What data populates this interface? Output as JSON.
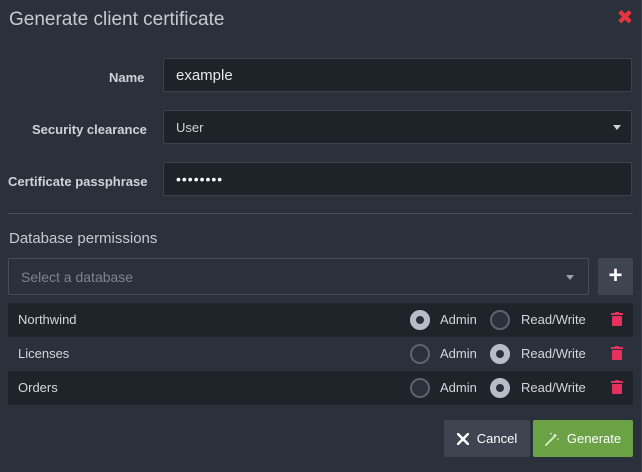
{
  "dialog": {
    "title": "Generate client certificate",
    "close_icon": "close-icon"
  },
  "form": {
    "name_label": "Name",
    "name_value": "example",
    "clearance_label": "Security clearance",
    "clearance_value": "User",
    "passphrase_label": "Certificate passphrase",
    "passphrase_value": "••••••••"
  },
  "permissions": {
    "section_title": "Database permissions",
    "select_placeholder": "Select a database",
    "add_label": "+",
    "option_admin": "Admin",
    "option_readwrite": "Read/Write",
    "rows": [
      {
        "name": "Northwind",
        "access": "Admin"
      },
      {
        "name": "Licenses",
        "access": "Read/Write"
      },
      {
        "name": "Orders",
        "access": "Read/Write"
      }
    ]
  },
  "buttons": {
    "cancel_label": "Cancel",
    "generate_label": "Generate"
  },
  "colors": {
    "accent_green": "#6aa245",
    "danger_red": "#e5353b",
    "delete_pink": "#e8305e"
  }
}
